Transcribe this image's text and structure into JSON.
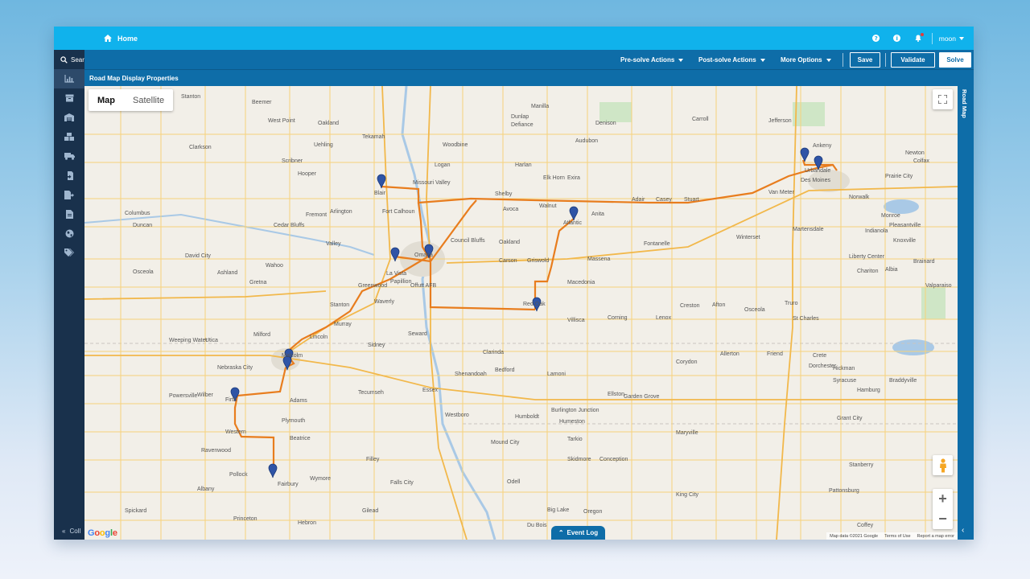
{
  "topbar": {
    "home_label": "Home",
    "user_name": "moon"
  },
  "sidebar": {
    "search_label": "Sear",
    "collapse_label": "Coll",
    "items": [
      "chart-icon",
      "box-icon",
      "warehouse-icon",
      "boxes-icon",
      "truck-icon",
      "doc-in-icon",
      "doc-out-icon",
      "document-icon",
      "globe-icon",
      "tags-icon"
    ]
  },
  "actionbar": {
    "presolve_label": "Pre-solve Actions",
    "postsolve_label": "Post-solve Actions",
    "more_label": "More Options",
    "save_label": "Save",
    "validate_label": "Validate",
    "solve_label": "Solve"
  },
  "subheader": {
    "title": "Road Map Display Properties"
  },
  "right_panel": {
    "label": "Road Map"
  },
  "map": {
    "map_tab": "Map",
    "satellite_tab": "Satellite",
    "google": "Google",
    "attribution": "Map data ©2021 Google",
    "terms": "Terms of Use",
    "report": "Report a map error",
    "event_log": "Event Log",
    "cities": [
      "Stanton",
      "Beemer",
      "West Point",
      "Oakland",
      "Tekamah",
      "Manilla",
      "Dunlap",
      "Defiance",
      "Denison",
      "Carroll",
      "Jefferson",
      "Ankeny",
      "Colfax",
      "Newton",
      "Clarkson",
      "Uehling",
      "Woodbine",
      "Audubon",
      "Scribner",
      "Hooper",
      "Logan",
      "Harlan",
      "Elk Horn",
      "Exira",
      "Urbandale",
      "Des Moines",
      "Prairie City",
      "Blair",
      "Missouri Valley",
      "Shelby",
      "Avoca",
      "Walnut",
      "Atlantic",
      "Anita",
      "Adair",
      "Casey",
      "Stuart",
      "Van Meter",
      "Norwalk",
      "Monroe",
      "Fremont",
      "Arlington",
      "Fort Calhoun",
      "Cedar Bluffs",
      "Columbus",
      "Duncan",
      "Omaha",
      "Council Bluffs",
      "Oakland",
      "Carson",
      "Griswold",
      "Massena",
      "Fontanelle",
      "Winterset",
      "Martensdale",
      "Indianola",
      "Pleasantville",
      "Knoxville",
      "Osceola",
      "David City",
      "Wahoo",
      "Valley",
      "La Vista",
      "Papillion",
      "Offutt AFB",
      "Macedonia",
      "Red Oak",
      "Villisca",
      "Corning",
      "Lenox",
      "Creston",
      "Afton",
      "Osceola",
      "Truro",
      "St Charles",
      "Liberty Center",
      "Chariton",
      "Albia",
      "Brainard",
      "Valparaiso",
      "Ashland",
      "Gretna",
      "Stanton",
      "Greenwood",
      "Waverly",
      "Murray",
      "Lincoln",
      "Seward",
      "Malcolm",
      "Utica",
      "Milford",
      "Weeping Water",
      "Nebraska City",
      "Sidney",
      "Essex",
      "Shenandoah",
      "Clarinda",
      "Bedford",
      "Lamoni",
      "Ellston",
      "Humeston",
      "Garden Grove",
      "Corydon",
      "Allerton",
      "Friend",
      "Dorchester",
      "Crete",
      "Hickman",
      "Syracuse",
      "Hamburg",
      "Braddyville",
      "Powersville",
      "Wilber",
      "Firth",
      "Adams",
      "Tecumseh",
      "Westboro",
      "Burlington Junction",
      "Grant City",
      "Western",
      "Plymouth",
      "Beatrice",
      "Filley",
      "Humboldt",
      "Tarkio",
      "Maryville",
      "Ravenwood",
      "Pollock",
      "Fairbury",
      "Wymore",
      "Falls City",
      "Mound City",
      "Skidmore",
      "Conception",
      "Stanberry",
      "Albany",
      "Princeton",
      "Hebron",
      "Gilead",
      "Odell",
      "Du Bois",
      "Big Lake",
      "Oregon",
      "King City",
      "Pattonsburg",
      "Coffey",
      "Spickard"
    ]
  }
}
